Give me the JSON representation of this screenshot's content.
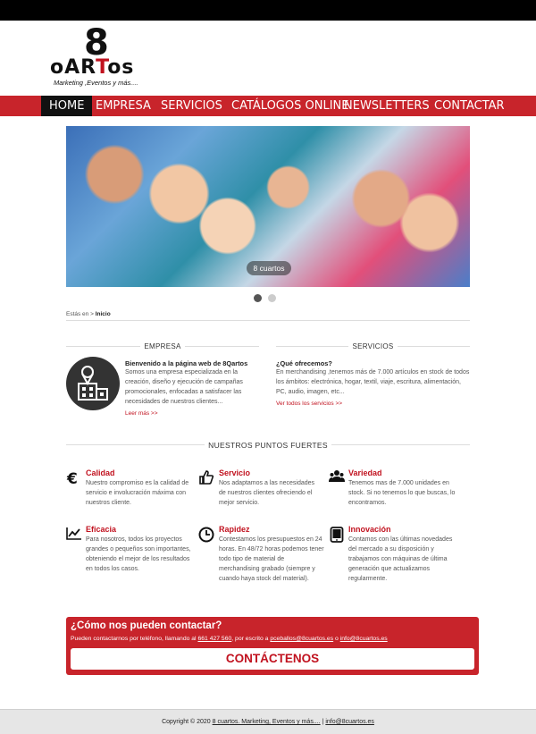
{
  "logo": {
    "number": "8",
    "word_a": "oAR",
    "word_b": "T",
    "word_c": "os",
    "tagline": "Marketing ,Eventos y más...."
  },
  "nav": {
    "items": [
      "HOME",
      "EMPRESA",
      "SERVICIOS",
      "CATÁLOGOS ONLINE",
      "NEWSLETTERS",
      "CONTACTAR"
    ],
    "active": "HOME"
  },
  "slider": {
    "caption": "8 cuartos",
    "current_slide": 1,
    "total_slides": 2
  },
  "breadcrumb": {
    "prefix": "Estás en >",
    "current": "Inicio"
  },
  "empresa": {
    "heading": "EMPRESA",
    "title": "Bienvenido a la página web de 8Qartos",
    "body": "Somos una empresa especializada en la creación, diseño y ejecución de campañas promocionales, enfocadas a satisfacer las necesidades de nuestros clientes...",
    "link": "Leer más >>"
  },
  "servicios": {
    "heading": "SERVICIOS",
    "title": "¿Qué ofrecemos?",
    "body": "En merchandising ,tenemos más de 7.000 artículos en stock de todos los ámbitos: electrónica, hogar, textil, viaje, escritura, alimentación, PC, audio, imagen, etc...",
    "link": "Ver todos los servicios >>"
  },
  "strengths": {
    "heading": "NUESTROS PUNTOS FUERTES",
    "items": [
      {
        "icon": "euro-icon",
        "title": "Calidad",
        "body": "Nuestro compromiso es la calidad de servicio e involucración máxima con nuestros cliente."
      },
      {
        "icon": "thumbs-up-icon",
        "title": "Servicio",
        "body": "Nos adaptamos a las necesidades de nuestros clientes ofreciendo el mejor servicio."
      },
      {
        "icon": "users-icon",
        "title": "Variedad",
        "body": "Tenemos mas de 7.000 unidades en stock. Si no tenemos lo que buscas, lo encontramos."
      },
      {
        "icon": "line-chart-icon",
        "title": "Eficacia",
        "body": "Para nosotros, todos los proyectos grandes o pequeños son importantes, obteniendo el mejor de los resultados en todos los casos."
      },
      {
        "icon": "clock-icon",
        "title": "Rapidez",
        "body": "Contestamos los presupuestos en 24 horas. En 48/72 horas podemos tener todo tipo de material de merchandising grabado (siempre y cuando haya stock del material)."
      },
      {
        "icon": "tablet-icon",
        "title": "Innovación",
        "body": "Contamos con las últimas novedades del mercado a su disposición y trabajamos con máquinas de última generación que actualizamos regularmente."
      }
    ]
  },
  "contact": {
    "question": "¿Cómo nos pueden contactar?",
    "text_a": "Pueden contactarnos por teléfono, llamando al",
    "phone": "661 427 560",
    "text_b": ", por escrito a",
    "email1": "pceballos@8cuartos.es",
    "text_c": "o",
    "email2": "info@8cuartos.es",
    "button": "CONTÁCTENOS"
  },
  "footer": {
    "prefix": "Copyright © 2020",
    "company_link": "8 cuartos. Marketing, Eventos y más....",
    "separator": "|",
    "email_link": "info@8cuartos.es"
  },
  "colors": {
    "brand_red": "#c8242b",
    "dark": "#111111",
    "footer_bg": "#e6e6e6"
  }
}
